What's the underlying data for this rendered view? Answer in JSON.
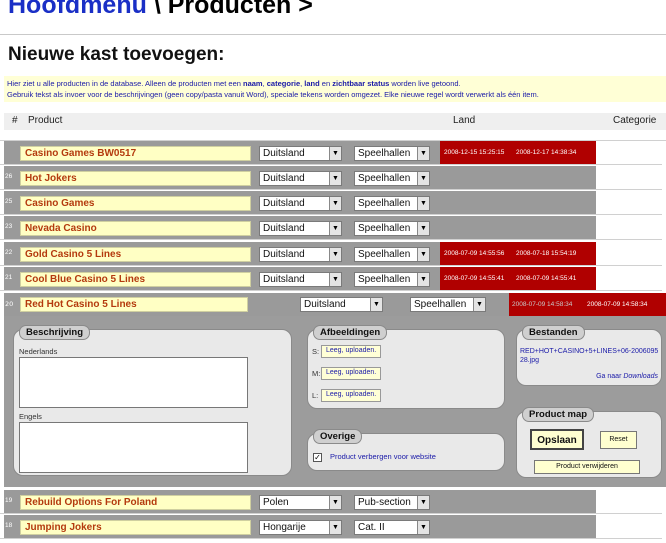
{
  "breadcrumb": {
    "home": "Hoofdmenu",
    "rest": " \\ Producten >"
  },
  "title": "Nieuwe kast toevoegen:",
  "intro": {
    "l1a": "Hier ziet u alle producten in de database. Alleen de producten met een ",
    "b1": "naam",
    "sep1": ", ",
    "b2": "categorie",
    "sep2": ", ",
    "b3": "land",
    "sep3": " en ",
    "b4": "zichtbaar status",
    "l1b": " worden live getoond.",
    "line2": "Gebruik tekst als invoer voor de beschrijvingen (geen copy/pasta vanuit Word), speciale tekens worden omgezet. Elke nieuwe regel wordt verwerkt als één item."
  },
  "columns": {
    "num": "#",
    "product": "Product",
    "land": "Land",
    "categorie": "Categorie"
  },
  "rows": [
    {
      "num": "",
      "name": "Casino Games BW0517",
      "country": "Duitsland",
      "category": "Speelhallen",
      "date1": "2008-12-15 15:25:15",
      "date2": "2008-12-17 14:38:34",
      "live": true
    },
    {
      "num": "26",
      "name": "Hot Jokers",
      "country": "Duitsland",
      "category": "Speelhallen",
      "date1": "",
      "date2": "",
      "live": false
    },
    {
      "num": "25",
      "name": "Casino Games",
      "country": "Duitsland",
      "category": "Speelhallen",
      "date1": "",
      "date2": "",
      "live": false
    },
    {
      "num": "23",
      "name": "Nevada Casino",
      "country": "Duitsland",
      "category": "Speelhallen",
      "date1": "",
      "date2": "",
      "live": false
    },
    {
      "num": "22",
      "name": "Gold Casino 5 Lines",
      "country": "Duitsland",
      "category": "Speelhallen",
      "date1": "2008-07-09 14:55:56",
      "date2": "2008-07-18 15:54:19",
      "live": true
    },
    {
      "num": "21",
      "name": "Cool Blue Casino 5 Lines",
      "country": "Duitsland",
      "category": "Speelhallen",
      "date1": "2008-07-09 14:55:41",
      "date2": "2008-07-09 14:55:41",
      "live": true
    }
  ],
  "edit_row": {
    "num": "20",
    "name": "Red Hot Casino 5 Lines",
    "country": "Duitsland",
    "category": "Speelhallen",
    "date1": "2008-07-09 14:58:34",
    "date2": "2008-07-09 14:58:34"
  },
  "beschrijving": {
    "title": "Beschrijving",
    "lang1": "Nederlands",
    "lang2": "Engels"
  },
  "afbeeldingen": {
    "title": "Afbeeldingen",
    "labels": [
      "S:",
      "M:",
      "L:"
    ],
    "button": "Leeg, uploaden."
  },
  "overige": {
    "title": "Overige",
    "checkbox_label": "Product verbergen voor website",
    "checked": true
  },
  "bestanden": {
    "title": "Bestanden",
    "file": "RED+HOT+CASINO+5+LINES+06-200609528.jpg",
    "goto_prefix": "Ga naar ",
    "goto_link": "Downloads"
  },
  "productmap": {
    "title": "Product map",
    "save": "Opslaan",
    "reset": "Reset",
    "delete": "Product verwijderen"
  },
  "rows_after": [
    {
      "num": "19",
      "name": "Rebuild Options For Poland",
      "country": "Polen",
      "category": "Pub-section",
      "date1": "",
      "date2": "",
      "live": false
    },
    {
      "num": "18",
      "name": "Jumping Jokers",
      "country": "Hongarije",
      "category": "Cat. II",
      "date1": "",
      "date2": "",
      "live": false
    }
  ],
  "colors": {
    "live": "#b00000",
    "name_bg": "#ffffc4",
    "name_text": "#b43a0e",
    "link": "#1a2fc6"
  }
}
